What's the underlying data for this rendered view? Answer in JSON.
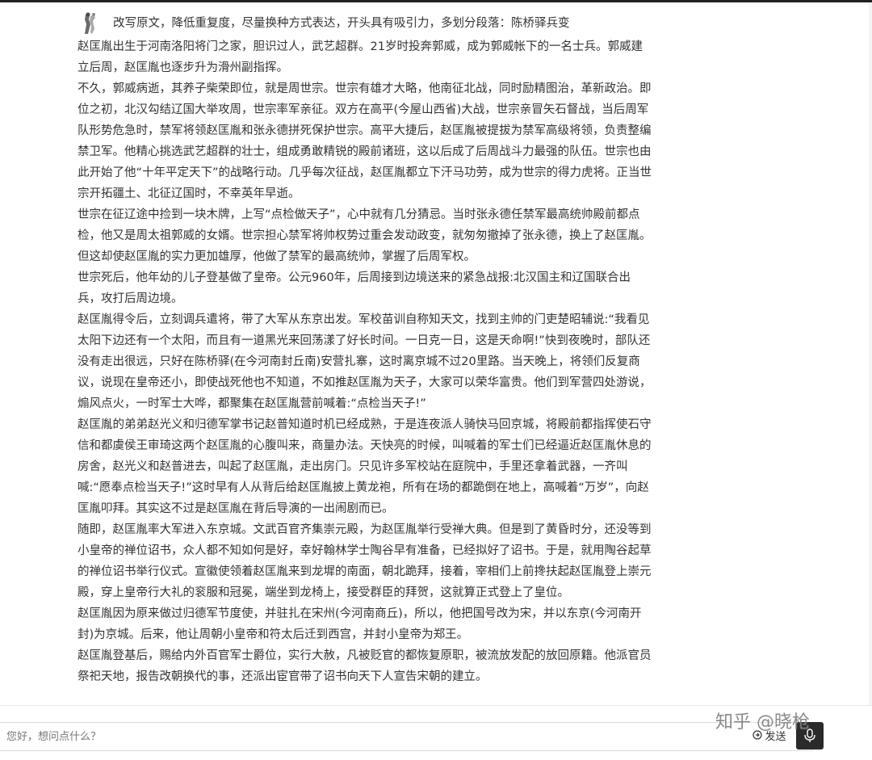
{
  "user_message": {
    "prompt": "改写原文，降低重复度，尽量换种方式表达，开头具有吸引力，多划分段落：陈桥驿兵变"
  },
  "reply": {
    "paragraphs": [
      "赵匡胤出生于河南洛阳将门之家，胆识过人，武艺超群。21岁时投奔郭威，成为郭威帐下的一名士兵。郭威建立后周，赵匡胤也逐步升为滑州副指挥。",
      "不久，郭威病逝，其养子柴荣即位，就是周世宗。世宗有雄才大略，他南征北战，同时励精图治，革新政治。即位之初，北汉勾结辽国大举攻周，世宗率军亲征。双方在高平(今屋山西省)大战，世宗亲冒矢石督战，当后周军队形势危急时，禁军将领赵匡胤和张永德拼死保护世宗。高平大捷后，赵匡胤被提拔为禁军高级将领，负责整编禁卫军。他精心挑选武艺超群的壮士，组成勇敢精锐的殿前诸班，这以后成了后周战斗力最强的队伍。世宗也由此开始了他“十年平定天下”的战略行动。几乎每次征战，赵匡胤都立下汗马功劳，成为世宗的得力虎将。正当世宗开拓疆土、北征辽国时，不幸英年早逝。",
      "世宗在征辽途中捡到一块木牌，上写“点检做天子”，心中就有几分猜忌。当时张永德任禁军最高统帅殿前都点检，他又是周太祖郭威的女婿。世宗担心禁军将帅权势过重会发动政变，就匆匆撤掉了张永德，换上了赵匡胤。但这却使赵匡胤的实力更加雄厚，他做了禁军的最高统帅，掌握了后周军权。",
      "世宗死后，他年幼的儿子登基做了皇帝。公元960年，后周接到边境送来的紧急战报:北汉国主和辽国联合出兵，攻打后周边境。",
      "赵匡胤得令后，立刻调兵遣将，带了大军从东京出发。军校苗训自称知天文，找到主帅的门吏楚昭辅说:“我看见太阳下边还有一个太阳，而且有一道黑光来回荡漾了好长时间。一日克一日，这是天命啊!”快到夜晚时，部队还没有走出很远，只好在陈桥驿(在今河南封丘南)安营扎寨，这时离京城不过20里路。当天晚上，将领们反复商议，说现在皇帝还小，即使战死他也不知道，不如推赵匡胤为天子，大家可以荣华富贵。他们到军营四处游说，煽风点火，一时军士大哗，都聚集在赵匡胤营前喊着:“点检当天子!”",
      "赵匡胤的弟弟赵光义和归德军掌书记赵普知道时机已经成熟，于是连夜派人骑快马回京城，将殿前都指挥使石守信和都虞侯王审琦这两个赵匡胤的心腹叫来，商量办法。天快亮的时候，叫喊着的军士们已经逼近赵匡胤休息的房舍，赵光义和赵普进去，叫起了赵匡胤，走出房门。只见许多军校站在庭院中，手里还拿着武器，一齐叫喊:“愿奉点检当天子!”这时早有人从背后给赵匡胤披上黄龙袍，所有在场的都跪倒在地上，高喊着“万岁”，向赵匡胤叩拜。其实这不过是赵匡胤在背后导演的一出闹剧而已。",
      "随即，赵匡胤率大军进入东京城。文武百官齐集崇元殿，为赵匡胤举行受禅大典。但是到了黄昏时分，还没等到小皇帝的禅位诏书，众人都不知如何是好，幸好翰林学士陶谷早有准备，已经拟好了诏书。于是，就用陶谷起草的禅位诏书举行仪式。宣徽使领着赵匡胤来到龙墀的南面，朝北跪拜，接着，宰相们上前搀扶起赵匡胤登上崇元殿，穿上皇帝行大礼的衮服和冠冕，端坐到龙椅上，接受群臣的拜贺，这就算正式登上了皇位。",
      "赵匡胤因为原来做过归德军节度使，并驻扎在宋州(今河南商丘)，所以，他把国号改为宋，并以东京(今河南开封)为京城。后来，他让周朝小皇帝和符太后迁到西宫，并封小皇帝为郑王。",
      "赵匡胤登基后，赐给内外百官军士爵位，实行大赦，凡被贬官的都恢复原职，被流放发配的放回原籍。他派官员祭祀天地，报告改朝换代的事，还派出宦官带了诏书向天下人宣告宋朝的建立。"
    ]
  },
  "composer": {
    "placeholder": "您好，想问点什么？",
    "send_label": "发送",
    "send_icon": "send-icon",
    "mic_icon": "microphone-icon"
  },
  "watermark": {
    "text": "知乎 @晓枪"
  },
  "colors": {
    "text": "#333333",
    "mic_button_bg": "#2a2a2a",
    "border": "#dcdcdc"
  }
}
